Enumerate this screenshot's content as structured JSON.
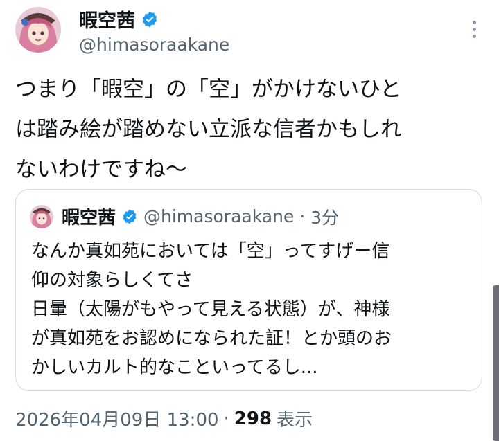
{
  "tweet": {
    "author": {
      "display_name": "暇空茜",
      "handle": "@himasoraakane",
      "avatar": "avatar-anime-girl",
      "verified_icon": "verified-badge-icon"
    },
    "text": "つまり「暇空」の「空」がかけないひと\nは踏み絵が踏めない立派な信者かもしれ\nないわけですね〜",
    "more_icon": "more-options-icon",
    "timestamp": "2026年04月09日 13:00",
    "separator": "·",
    "views_count": "298",
    "views_label": "表示"
  },
  "quoted_tweet": {
    "display_name": "暇空茜",
    "handle": "@himasoraakane",
    "separator": "·",
    "time": "3分",
    "text": "なんか真如苑においては「空」ってすげー信\n仰の対象らしくてさ\n日暈（太陽がもやって見える状態）が、神様\nが真如苑をお認めになられた証！とか頭のお\nかしいカルト的なこといってるし..."
  },
  "colors": {
    "text": "#0f1419",
    "secondary": "#536471",
    "verified": "#1d9bf0",
    "border": "#cfd9de"
  }
}
